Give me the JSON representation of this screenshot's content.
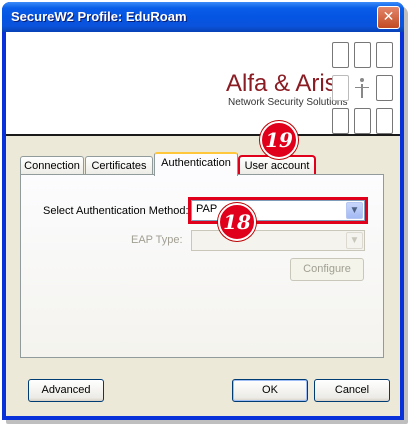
{
  "window": {
    "title": "SecureW2 Profile: EduRoam",
    "close_glyph": "✕"
  },
  "banner": {
    "brand": "Alfa & Ariss",
    "tagline": "Network Security Solutions"
  },
  "tabs": [
    {
      "label": "Connection"
    },
    {
      "label": "Certificates"
    },
    {
      "label": "Authentication"
    },
    {
      "label": "User account"
    }
  ],
  "auth": {
    "method_label": "Select Authentication Method:",
    "method_value": "PAP",
    "eap_label": "EAP Type:",
    "eap_value": "",
    "configure_label": "Configure"
  },
  "buttons": {
    "advanced": "Advanced",
    "ok": "OK",
    "cancel": "Cancel"
  },
  "callouts": {
    "tab": "19",
    "combo": "18"
  },
  "colors": {
    "accent": "#e0001b",
    "brand": "#8a1c23",
    "titlebar": "#0554e3"
  }
}
